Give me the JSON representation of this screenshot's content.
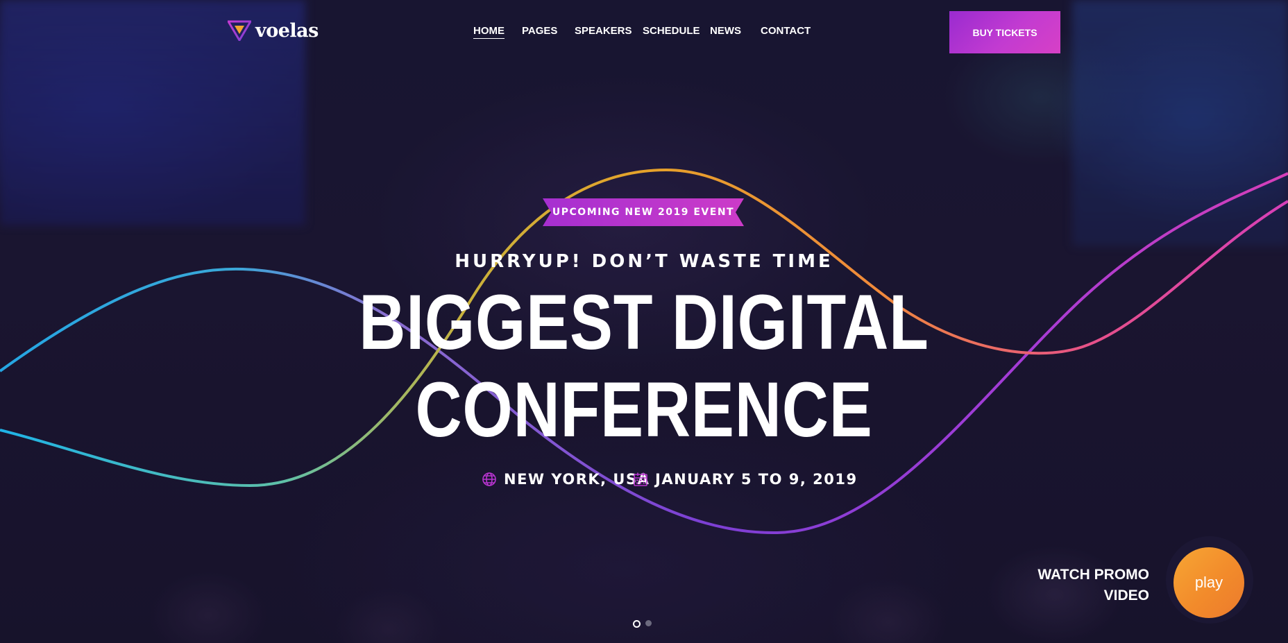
{
  "brand": {
    "name": "voelas"
  },
  "nav": {
    "items": [
      {
        "label": "HOME",
        "active": true
      },
      {
        "label": "PAGES",
        "active": false
      },
      {
        "label": "SPEAKERS",
        "active": false
      },
      {
        "label": "SCHEDULE",
        "active": false
      },
      {
        "label": "NEWS",
        "active": false
      },
      {
        "label": "CONTACT",
        "active": false
      }
    ],
    "cta_label": "BUY TICKETS"
  },
  "hero": {
    "ribbon": "UPCOMING NEW 2019 EVENT",
    "eyebrow": "HURRYUP! DON’T WASTE TIME",
    "headline_line1": "BIGGEST DIGITAL",
    "headline_line2": "CONFERENCE",
    "location": "NEW YORK, USA",
    "date": "JANUARY 5 TO 9, 2019",
    "location_icon": "globe-icon",
    "date_icon": "calendar-icon"
  },
  "promo": {
    "line1": "WATCH PROMO",
    "line2": "VIDEO",
    "play_label": "play"
  },
  "slider": {
    "slides": 2,
    "active_index": 0
  },
  "colors": {
    "accent_purple": "#b834d0",
    "accent_magenta": "#d63fb8",
    "accent_orange": "#f39130",
    "wave_blue": "#2fb0e0",
    "wave_gold": "#e6a52c",
    "background": "#17142e"
  }
}
